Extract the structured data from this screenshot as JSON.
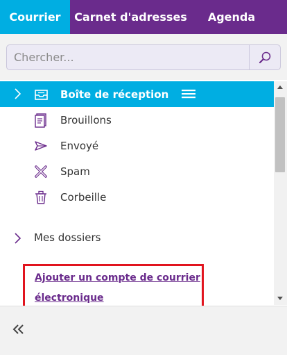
{
  "tabs": [
    {
      "label": "Courrier",
      "active": true
    },
    {
      "label": "Carnet d'adresses",
      "active": false
    },
    {
      "label": "Agenda",
      "active": false
    }
  ],
  "search": {
    "placeholder": "Chercher...",
    "value": "",
    "icon": "search-icon"
  },
  "folders": [
    {
      "label": "Boîte de réception",
      "icon": "inbox-icon",
      "selected": true
    },
    {
      "label": "Brouillons",
      "icon": "draft-icon",
      "selected": false
    },
    {
      "label": "Envoyé",
      "icon": "sent-icon",
      "selected": false
    },
    {
      "label": "Spam",
      "icon": "spam-icon",
      "selected": false
    },
    {
      "label": "Corbeille",
      "icon": "trash-icon",
      "selected": false
    }
  ],
  "my_folders": {
    "label": "Mes dossiers",
    "icon": "chevron-right-icon"
  },
  "add_account": {
    "label": "Ajouter un compte de courrier électronique"
  },
  "footer": {
    "collapse_icon": "double-chevron-left-icon"
  },
  "colors": {
    "primary": "#6a2b8c",
    "active_tab": "#00aee2",
    "highlight_border": "#e1141e"
  }
}
